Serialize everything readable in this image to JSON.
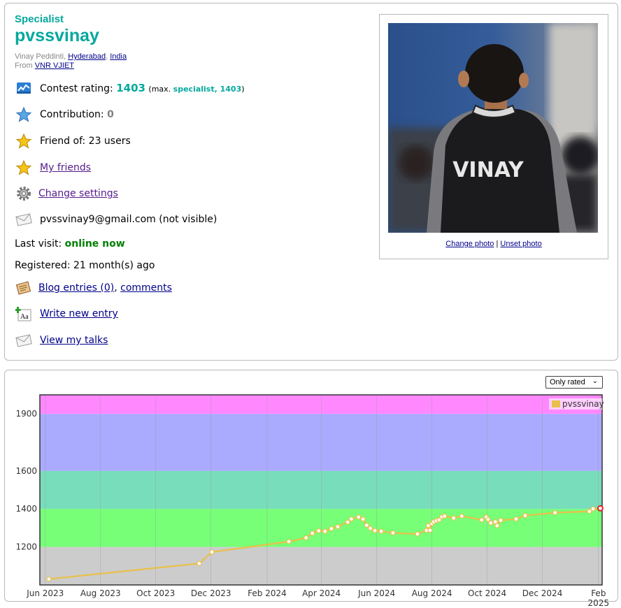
{
  "profile": {
    "rank": "Specialist",
    "handle": "pvssvinay",
    "name_prefix": "Vinay Peddinti, ",
    "city": "Hyderabad",
    "sep": ", ",
    "country": "India",
    "from_label": "From ",
    "org": "VNR VJIET",
    "contest_rating_label": "Contest rating: ",
    "contest_rating": "1403",
    "max_prefix": "(max. ",
    "max_value": "specialist, 1403",
    "max_suffix": ")",
    "contribution_label": "Contribution: ",
    "contribution": "0",
    "friend_of": "Friend of: 23 users",
    "my_friends": "My friends",
    "change_settings": "Change settings",
    "email": "pvssvinay9@gmail.com (not visible)",
    "last_visit_label": "Last visit: ",
    "last_visit": "online now",
    "registered": "Registered: 21 month(s) ago",
    "blog_entries": "Blog entries (0)",
    "comma": ", ",
    "comments": "comments",
    "write_new_entry": "Write new entry",
    "view_talks": "View my talks",
    "photo_text": "VINAY",
    "change_photo": "Change photo",
    "pipe": " | ",
    "unset_photo": "Unset photo"
  },
  "icons": [
    "rating-icon",
    "star-blue-icon",
    "star-icon",
    "star-icon",
    "gear-icon",
    "envelope-icon",
    "blog-icon",
    "write-icon",
    "envelope-icon"
  ],
  "chart_controls": {
    "range_select": "Only rated",
    "caret": "⌄"
  },
  "chart_data": {
    "type": "line",
    "legend_position": "top-right",
    "grid": true,
    "series": [
      {
        "name": "pvssvinay",
        "color": "#e8c04a",
        "x": [
          "2023-06-05",
          "2023-11-18",
          "2023-12-02",
          "2024-02-25",
          "2024-03-15",
          "2024-03-22",
          "2024-03-29",
          "2024-04-05",
          "2024-04-12",
          "2024-04-19",
          "2024-04-30",
          "2024-05-04",
          "2024-05-12",
          "2024-05-17",
          "2024-05-21",
          "2024-05-25",
          "2024-05-30",
          "2024-06-06",
          "2024-06-19",
          "2024-07-16",
          "2024-07-26",
          "2024-07-28",
          "2024-07-30",
          "2024-08-01",
          "2024-08-03",
          "2024-08-06",
          "2024-08-09",
          "2024-08-12",
          "2024-08-15",
          "2024-08-25",
          "2024-09-03",
          "2024-09-25",
          "2024-09-30",
          "2024-10-02",
          "2024-10-05",
          "2024-10-10",
          "2024-10-12",
          "2024-10-16",
          "2024-11-02",
          "2024-11-12",
          "2024-12-15",
          "2025-01-22",
          "2025-01-26",
          "2025-02-03"
        ],
        "y": [
          1031,
          1113,
          1173,
          1228,
          1248,
          1272,
          1285,
          1282,
          1296,
          1306,
          1330,
          1347,
          1357,
          1346,
          1314,
          1298,
          1286,
          1282,
          1274,
          1268,
          1287,
          1312,
          1287,
          1323,
          1332,
          1338,
          1342,
          1358,
          1362,
          1352,
          1362,
          1342,
          1357,
          1345,
          1326,
          1332,
          1312,
          1340,
          1347,
          1365,
          1380,
          1387,
          1400,
          1403
        ]
      }
    ],
    "y_ticks": [
      1200,
      1400,
      1600,
      1900
    ],
    "x_ticks": [
      "Jun 2023",
      "Aug 2023",
      "Oct 2023",
      "Dec 2023",
      "Feb 2024",
      "Apr 2024",
      "Jun 2024",
      "Aug 2024",
      "Oct 2024",
      "Dec 2024",
      "Feb 2025"
    ],
    "rank_bands": [
      {
        "from": 0,
        "to": 1200,
        "color": "#cccccc"
      },
      {
        "from": 1200,
        "to": 1400,
        "color": "#77ff77"
      },
      {
        "from": 1400,
        "to": 1600,
        "color": "#77ddbb"
      },
      {
        "from": 1600,
        "to": 1900,
        "color": "#aaaaff"
      },
      {
        "from": 1900,
        "to": 2100,
        "color": "#ff88ff"
      }
    ]
  }
}
